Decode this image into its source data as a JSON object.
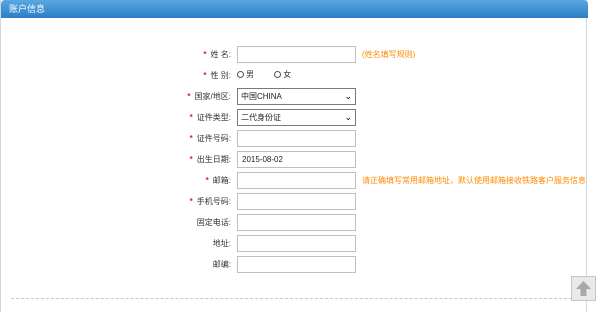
{
  "panel": {
    "title": "账户信息"
  },
  "required_marker": "*",
  "form": {
    "name": {
      "label": "姓 名:",
      "value": "",
      "hint": "(姓名填写规则)"
    },
    "gender": {
      "label": "性 别:",
      "options": [
        "男",
        "女"
      ]
    },
    "country": {
      "label": "国家/地区:",
      "value": "中国CHINA"
    },
    "id_type": {
      "label": "证件类型:",
      "value": "二代身份证"
    },
    "id_number": {
      "label": "证件号码:",
      "value": ""
    },
    "birthdate": {
      "label": "出生日期:",
      "value": "2015-08-02"
    },
    "email": {
      "label": "邮箱:",
      "value": "",
      "hint": "请正确填写常用邮箱地址，默认使用邮箱接收铁路客户服务信息"
    },
    "mobile": {
      "label": "手机号码:",
      "value": ""
    },
    "phone": {
      "label": "固定电话:",
      "value": ""
    },
    "address": {
      "label": "地址:",
      "value": ""
    },
    "postcode": {
      "label": "邮编:",
      "value": ""
    }
  },
  "icons": {
    "select_arrow": "chevron-down-icon",
    "back_to_top": "arrow-up-icon"
  },
  "colors": {
    "header": "#2a7ec8",
    "required": "#e02222",
    "hint": "#ff8a00"
  }
}
